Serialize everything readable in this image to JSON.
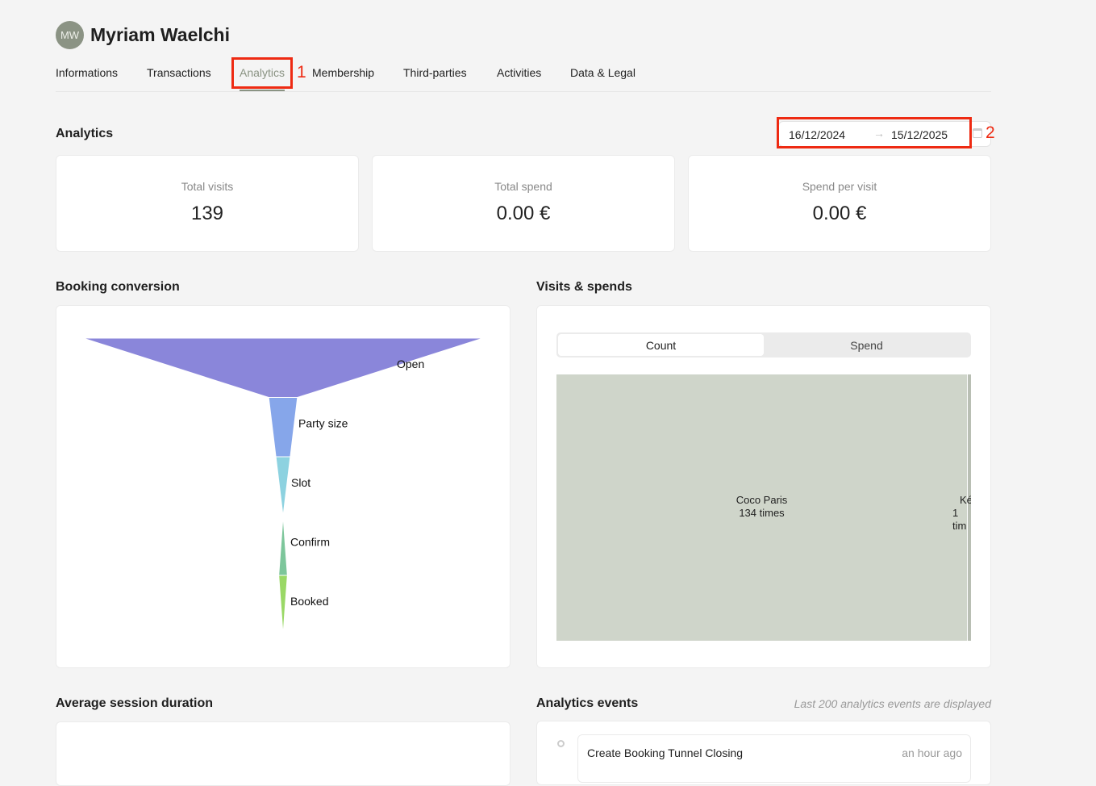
{
  "header": {
    "initials": "MW",
    "name": "Myriam Waelchi"
  },
  "tabs": [
    "Informations",
    "Transactions",
    "Analytics",
    "Membership",
    "Third-parties",
    "Activities",
    "Data & Legal"
  ],
  "annotations": [
    "1",
    "2"
  ],
  "analytics": {
    "title": "Analytics",
    "date_from": "16/12/2024",
    "date_to": "15/12/2025",
    "stats": [
      {
        "label": "Total visits",
        "value": "139"
      },
      {
        "label": "Total spend",
        "value": "0.00 €"
      },
      {
        "label": "Spend per visit",
        "value": "0.00 €"
      }
    ]
  },
  "booking": {
    "title": "Booking conversion"
  },
  "visits": {
    "title": "Visits & spends",
    "toggle": [
      "Count",
      "Spend"
    ],
    "treemap": [
      {
        "name": "Coco Paris",
        "label": "134 times",
        "value": 134,
        "color": "#cfd5ca"
      },
      {
        "name": "Ké",
        "label": "1 tim",
        "value": 1,
        "color": "#c2c8bd"
      }
    ]
  },
  "session": {
    "title": "Average session duration"
  },
  "events": {
    "title": "Analytics events",
    "note": "Last 200 analytics events are displayed",
    "items": [
      {
        "name": "Create Booking Tunnel Closing",
        "time": "an hour ago"
      }
    ]
  },
  "chart_data": {
    "type": "funnel",
    "stages": [
      "Open",
      "Party size",
      "Slot",
      "Confirm",
      "Booked"
    ],
    "values": [
      139,
      10,
      5,
      0,
      3
    ],
    "colors": [
      "#8a86da",
      "#86a6ea",
      "#8dd2e0",
      "#7dc69b",
      "#9ad866"
    ]
  }
}
